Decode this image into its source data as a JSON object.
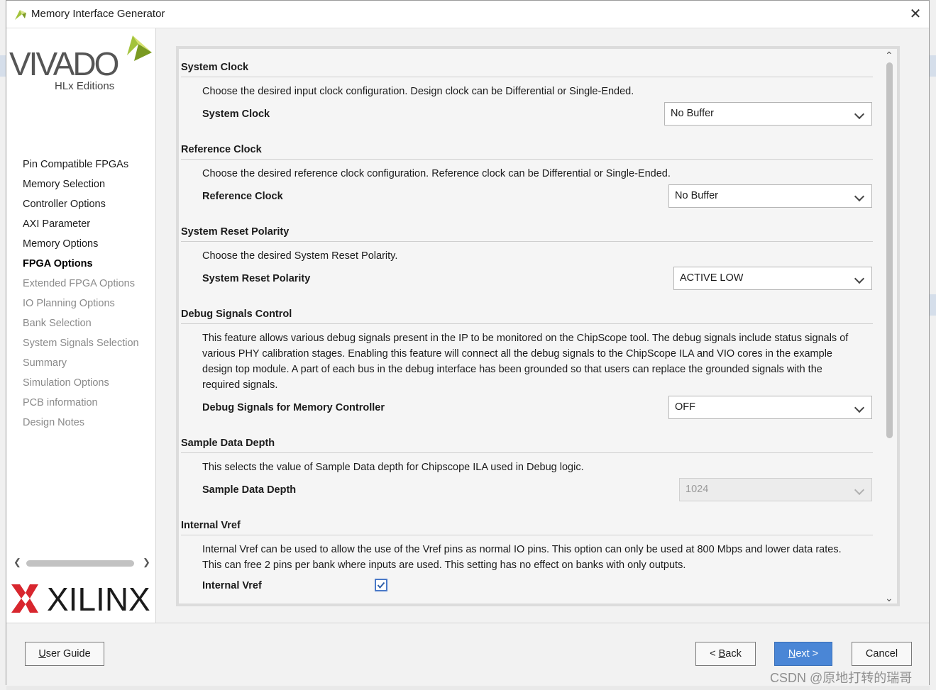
{
  "window": {
    "title": "Memory Interface Generator"
  },
  "logo": {
    "vivado": "VIVADO",
    "edition": "HLx Editions",
    "xilinx": "XILINX"
  },
  "nav": [
    {
      "label": "Pin Compatible FPGAs",
      "state": "done"
    },
    {
      "label": "Memory Selection",
      "state": "done"
    },
    {
      "label": "Controller Options",
      "state": "done"
    },
    {
      "label": "AXI Parameter",
      "state": "done"
    },
    {
      "label": "Memory Options",
      "state": "done"
    },
    {
      "label": "FPGA Options",
      "state": "current"
    },
    {
      "label": "Extended FPGA Options",
      "state": "todo"
    },
    {
      "label": "IO Planning Options",
      "state": "todo"
    },
    {
      "label": "Bank Selection",
      "state": "todo"
    },
    {
      "label": "System Signals Selection",
      "state": "todo"
    },
    {
      "label": "Summary",
      "state": "todo"
    },
    {
      "label": "Simulation Options",
      "state": "todo"
    },
    {
      "label": "PCB information",
      "state": "todo"
    },
    {
      "label": "Design Notes",
      "state": "todo"
    }
  ],
  "sections": {
    "system_clock": {
      "title": "System Clock",
      "desc": "Choose the desired input clock configuration. Design clock can be Differential or Single-Ended.",
      "label": "System Clock",
      "value": "No Buffer"
    },
    "reference_clock": {
      "title": "Reference Clock",
      "desc": "Choose the desired reference clock configuration. Reference clock can be Differential or Single-Ended.",
      "label": "Reference Clock",
      "value": "No Buffer"
    },
    "reset_polarity": {
      "title": "System Reset Polarity",
      "desc": "Choose the desired System Reset Polarity.",
      "label": "System Reset Polarity",
      "value": "ACTIVE LOW"
    },
    "debug": {
      "title": "Debug Signals Control",
      "desc_lines": [
        "This feature allows various debug signals present in the IP to be monitored on the ChipScope tool. The debug signals include status signals of",
        "various PHY calibration stages. Enabling this feature will connect all the debug signals to the ChipScope ILA and VIO cores in the example",
        "design top module. A part of each bus in the debug interface has been grounded so that users can replace the grounded signals with the",
        "required signals."
      ],
      "label": "Debug Signals for Memory Controller",
      "value": "OFF"
    },
    "sample_depth": {
      "title": "Sample Data Depth",
      "desc": "This selects the value of Sample Data depth for Chipscope ILA used in Debug logic.",
      "label": "Sample Data Depth",
      "value": "1024"
    },
    "internal_vref": {
      "title": "Internal Vref",
      "desc_lines": [
        "Internal Vref can be used to allow the use of the Vref pins as normal IO pins. This option can only be used at 800 Mbps and lower data rates.",
        "This can free 2 pins per bank where inputs are used. This setting has no effect on banks with only outputs."
      ],
      "label": "Internal Vref",
      "checked": true
    }
  },
  "buttons": {
    "user_guide_u": "U",
    "user_guide_rest": "ser Guide",
    "back_pre": "< ",
    "back_u": "B",
    "back_rest": "ack",
    "next_u": "N",
    "next_rest": "ext >",
    "cancel": "Cancel"
  },
  "watermark": "CSDN @原地打转的瑞哥",
  "colors": {
    "primary": "#4a86d6",
    "vivado_green": "#a3c33b",
    "xilinx_red": "#d8262e"
  }
}
